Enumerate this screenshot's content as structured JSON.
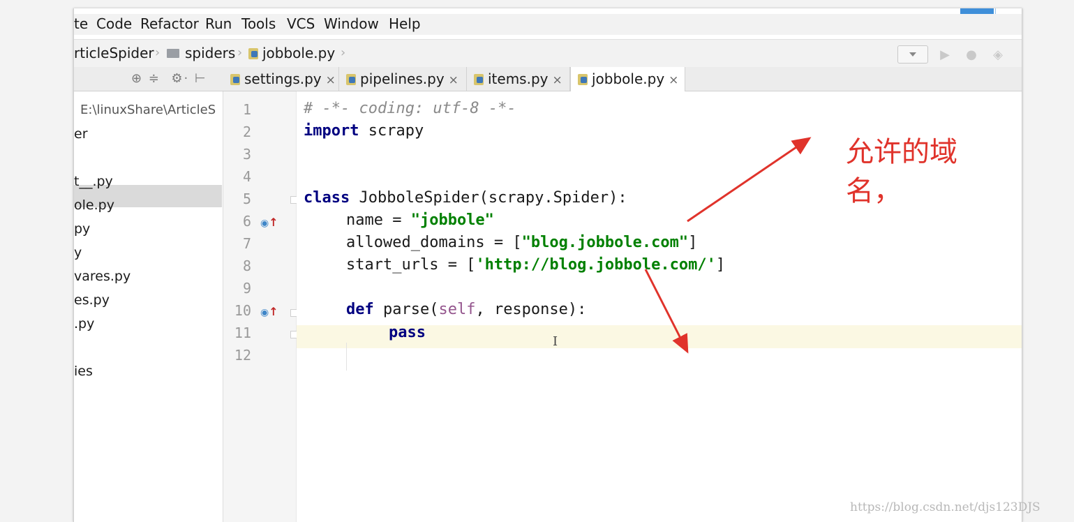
{
  "menu": [
    "te",
    "Code",
    "Refactor",
    "Run",
    "Tools",
    "VCS",
    "Window",
    "Help"
  ],
  "breadcrumb": {
    "project": "rticleSpider",
    "folder": "spiders",
    "file": "jobbole.py"
  },
  "tabs": [
    {
      "label": "settings.py",
      "close": "×"
    },
    {
      "label": "pipelines.py",
      "close": "×"
    },
    {
      "label": "items.py",
      "close": "×"
    },
    {
      "label": "jobbole.py",
      "close": "×",
      "active": true
    }
  ],
  "project_panel": {
    "path": "E:\\linuxShare\\ArticleS",
    "items": [
      "er",
      "t__.py",
      "ole.py",
      "py",
      "y",
      "vares.py",
      "es.py",
      ".py",
      "ies"
    ]
  },
  "line_numbers": [
    "1",
    "2",
    "3",
    "4",
    "5",
    "6",
    "7",
    "8",
    "9",
    "10",
    "11",
    "12"
  ],
  "code": {
    "line1": "# -*- coding: utf-8 -*-",
    "import_kw": "import",
    "import_mod": " scrapy",
    "class_kw": "class",
    "class_rest": " JobboleSpider(scrapy.Spider):",
    "name_lhs": "name = ",
    "name_val": "\"jobbole\"",
    "allowed_lhs": "allowed_domains = [",
    "allowed_val": "\"blog.jobbole.com\"",
    "allowed_end": "]",
    "start_lhs": "start_urls = [",
    "start_val": "'http://blog.jobbole.com/'",
    "start_end": "]",
    "def_kw": "def",
    "def_name": " parse(",
    "def_self": "self",
    "def_rest": ", response):",
    "pass_kw": "pass"
  },
  "annotation": "允许的域名，",
  "watermark": "https://blog.csdn.net/djs123DJS",
  "colors": {
    "annotation": "#e0332b",
    "keyword": "#000080",
    "string": "#008000",
    "comment": "#8a8a8a"
  }
}
